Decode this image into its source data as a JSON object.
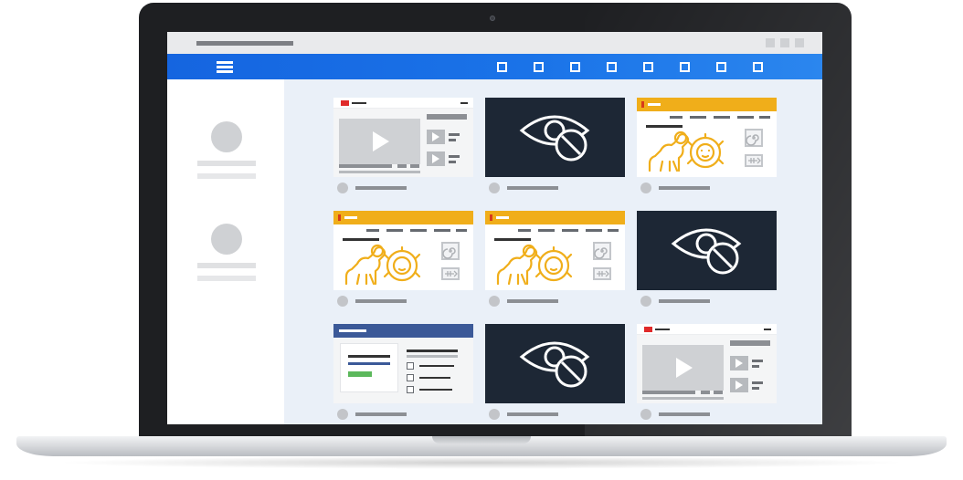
{
  "device": {
    "type": "laptop"
  },
  "browser": {
    "window_controls": [
      "minimize-icon",
      "maximize-icon",
      "close-icon"
    ],
    "accent_color": "#1a73e8"
  },
  "navbar": {
    "menu_icon": "hamburger-menu-icon",
    "nav_items": [
      "square-nav-icon-1",
      "square-nav-icon-2",
      "square-nav-icon-3",
      "square-nav-icon-4",
      "square-nav-icon-5",
      "square-nav-icon-6",
      "square-nav-icon-7",
      "square-nav-icon-8"
    ]
  },
  "sidebar": {
    "profiles": [
      {
        "avatar": "avatar-placeholder"
      },
      {
        "avatar": "avatar-placeholder"
      }
    ]
  },
  "grid": {
    "columns": 3,
    "tiles": [
      {
        "kind": "video-page",
        "icon": "play-icon"
      },
      {
        "kind": "hidden-content",
        "icon": "eye-blocked-icon"
      },
      {
        "kind": "lion-news-page",
        "icon": "lion-icon"
      },
      {
        "kind": "lion-news-page",
        "icon": "lion-icon"
      },
      {
        "kind": "lion-news-page",
        "icon": "lion-icon"
      },
      {
        "kind": "hidden-content",
        "icon": "eye-blocked-icon"
      },
      {
        "kind": "social-form-page",
        "icon": "checkbox-icon"
      },
      {
        "kind": "hidden-content",
        "icon": "eye-blocked-icon"
      },
      {
        "kind": "video-page",
        "icon": "play-icon"
      }
    ]
  },
  "colors": {
    "hidden_tile_bg": "#1d2735",
    "lion_accent": "#f0ae1a",
    "video_logo": "#e02a2a",
    "form_header": "#3b5998",
    "form_button": "#5cb85c"
  }
}
